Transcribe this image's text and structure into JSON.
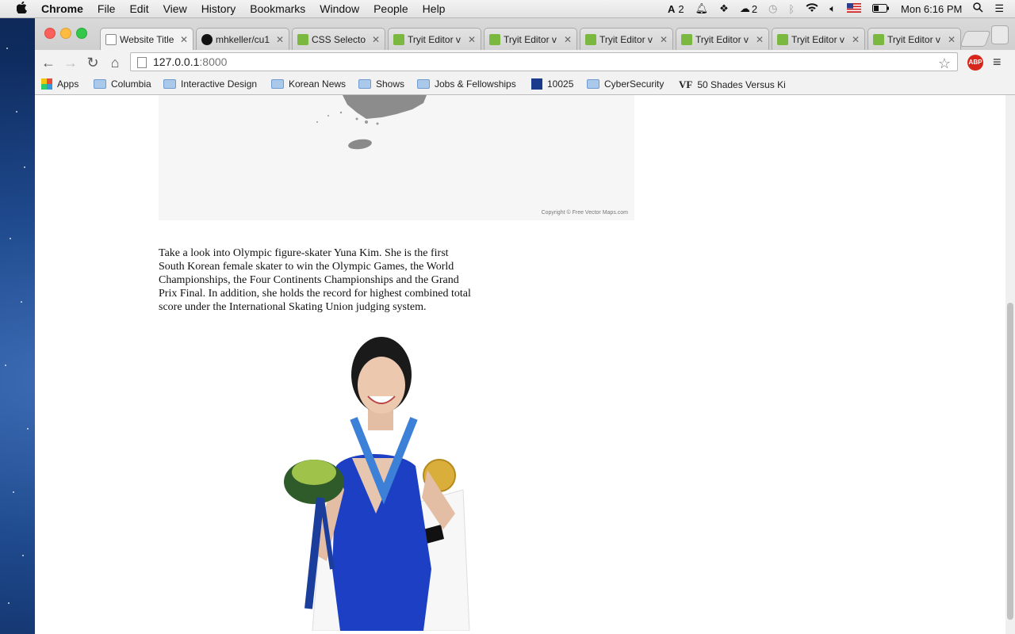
{
  "menubar": {
    "apple": "",
    "app": "Chrome",
    "items": [
      "File",
      "Edit",
      "View",
      "History",
      "Bookmarks",
      "Window",
      "People",
      "Help"
    ],
    "status": {
      "adobe_count": "2",
      "cc_count": "2",
      "clock": "Mon 6:16 PM"
    }
  },
  "tabs": [
    {
      "title": "Website Title",
      "favicon": "page-icon",
      "active": true
    },
    {
      "title": "mhkeller/cu1",
      "favicon": "github-icon",
      "active": false
    },
    {
      "title": "CSS Selecto",
      "favicon": "w3schools-icon",
      "active": false
    },
    {
      "title": "Tryit Editor v",
      "favicon": "w3schools-icon",
      "active": false
    },
    {
      "title": "Tryit Editor v",
      "favicon": "w3schools-icon",
      "active": false
    },
    {
      "title": "Tryit Editor v",
      "favicon": "w3schools-icon",
      "active": false
    },
    {
      "title": "Tryit Editor v",
      "favicon": "w3schools-icon",
      "active": false
    },
    {
      "title": "Tryit Editor v",
      "favicon": "w3schools-icon",
      "active": false
    },
    {
      "title": "Tryit Editor v",
      "favicon": "w3schools-icon",
      "active": false
    }
  ],
  "toolbar": {
    "url_host": "127.0.0.1",
    "url_port": ":8000",
    "abp_label": "ABP"
  },
  "bookmarks": [
    {
      "label": "Apps",
      "icon": "apps-icon"
    },
    {
      "label": "Columbia",
      "icon": "folder-icon"
    },
    {
      "label": "Interactive Design",
      "icon": "folder-icon"
    },
    {
      "label": "Korean News",
      "icon": "folder-icon"
    },
    {
      "label": "Shows",
      "icon": "folder-icon"
    },
    {
      "label": "Jobs & Fellowships",
      "icon": "folder-icon"
    },
    {
      "label": "10025",
      "icon": "weather-channel-icon"
    },
    {
      "label": "CyberSecurity",
      "icon": "folder-icon"
    },
    {
      "label": "50 Shades Versus Ki",
      "icon": "vanity-fair-icon"
    }
  ],
  "page": {
    "map_copyright": "Copyright © Free Vector Maps.com",
    "article_text": "Take a look into Olympic figure-skater Yuna Kim. She is the first South Korean female skater to win the Olympic Games, the World Championships, the Four Continents Championships and the Grand Prix Final. In addition, she holds the record for highest combined total score under the International Skating Union judging system."
  },
  "colors": {
    "tab_w3_favicon": "#7bb83f",
    "abp_red": "#d7261b",
    "dress_blue": "#1d3fc4"
  }
}
